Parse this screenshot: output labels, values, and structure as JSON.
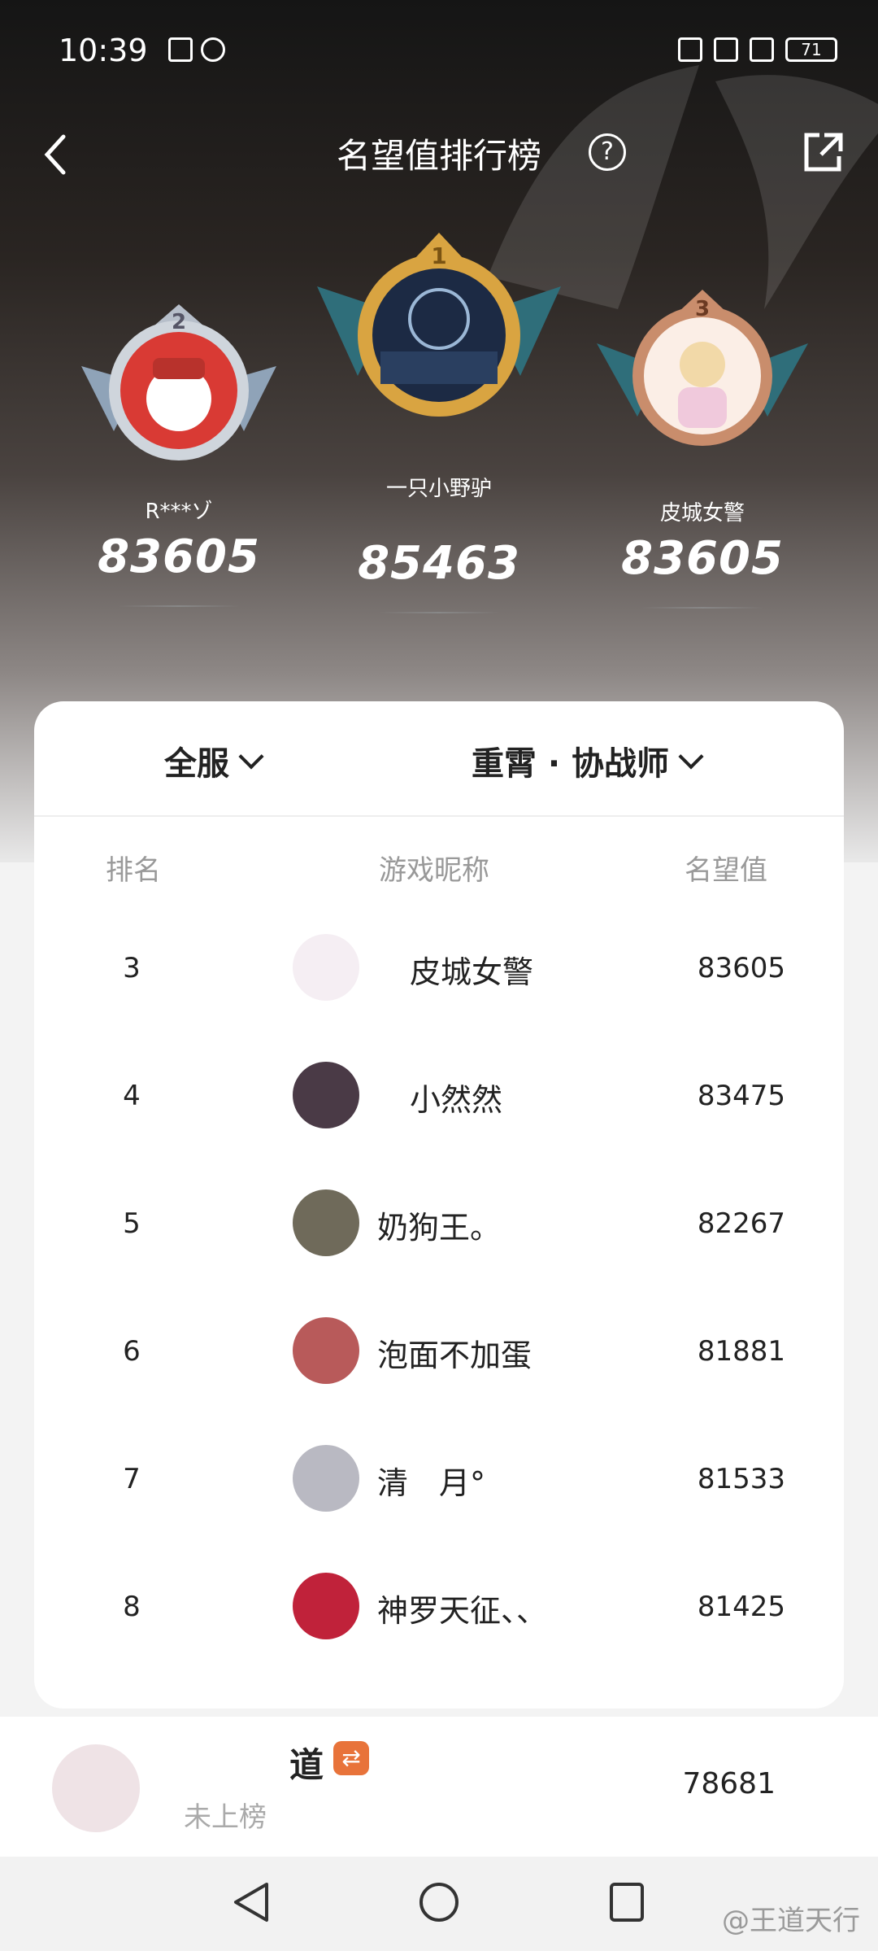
{
  "status_bar": {
    "time": "10:39",
    "battery": "71"
  },
  "header": {
    "title": "名望值排行榜",
    "help_label": "?"
  },
  "podium": [
    {
      "rank": "2",
      "name": "R***ゾ",
      "score": "83605"
    },
    {
      "rank": "1",
      "name": "一只小野驴",
      "score": "85463"
    },
    {
      "rank": "3",
      "name": "皮城女警",
      "score": "83605"
    }
  ],
  "filters": {
    "region": "全服",
    "hero": "重霄 · 协战师"
  },
  "columns": {
    "rank": "排名",
    "nickname": "游戏昵称",
    "score": "名望值"
  },
  "rows": [
    {
      "rank": "3",
      "name": "皮城女警",
      "score": "83605"
    },
    {
      "rank": "4",
      "name": "小然然",
      "score": "83475"
    },
    {
      "rank": "5",
      "name": "奶狗王。",
      "score": "82267"
    },
    {
      "rank": "6",
      "name": "泡面不加蛋",
      "score": "81881"
    },
    {
      "rank": "7",
      "name": "清　月°",
      "score": "81533"
    },
    {
      "rank": "8",
      "name": "神罗天征、、",
      "score": "81425"
    }
  ],
  "me": {
    "name": "道",
    "tag": "⇄",
    "status": "未上榜",
    "score": "78681"
  },
  "watermark": "@王道天行",
  "colors": {
    "accent": "#e8733a",
    "gold": "#d9a441",
    "silver": "#b7bfca",
    "bronze": "#c98d6c"
  }
}
